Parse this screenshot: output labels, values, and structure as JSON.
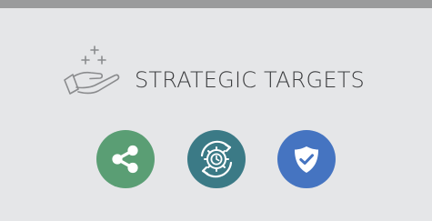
{
  "title": "STRATEGIC TARGETS",
  "icons": [
    {
      "name": "share-icon",
      "color": "#5a9e74"
    },
    {
      "name": "gear-cycle-clock-icon",
      "color": "#3b7a86"
    },
    {
      "name": "shield-check-icon",
      "color": "#4574c1"
    }
  ],
  "colors": {
    "background": "#e5e6e8",
    "top_bar": "#9a9b9c",
    "title_text": "#3c3d3f",
    "hand_icon": "#8a8b8d"
  }
}
